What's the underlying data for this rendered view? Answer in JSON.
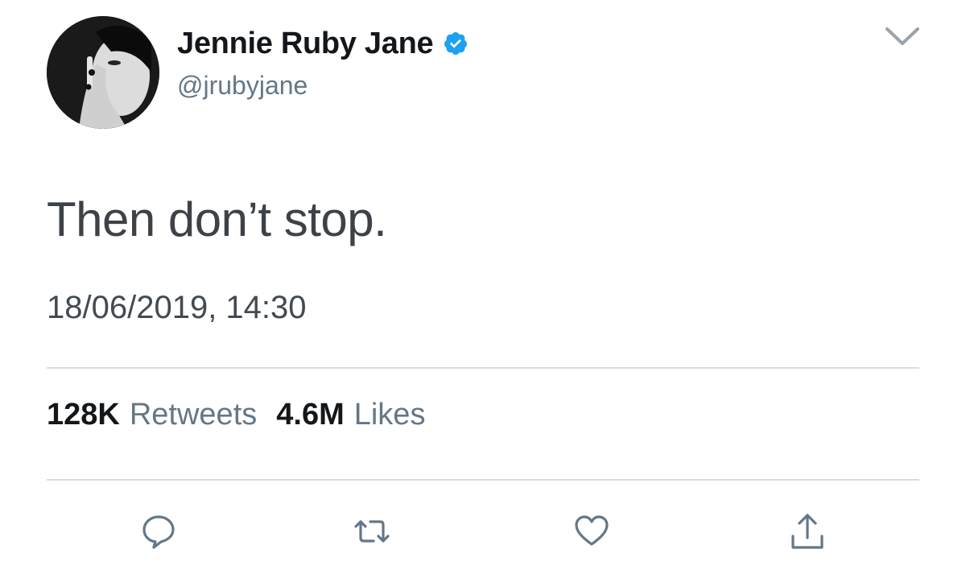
{
  "tweet": {
    "author": {
      "display_name": "Jennie Ruby Jane",
      "handle": "@jrubyjane",
      "verified": true
    },
    "text": "Then don’t stop.",
    "timestamp": "18/06/2019, 14:30",
    "stats": {
      "retweets_count": "128K",
      "retweets_label": "Retweets",
      "likes_count": "4.6M",
      "likes_label": "Likes"
    }
  },
  "icons": {
    "verified": "verified-badge-icon",
    "menu": "chevron-down-icon",
    "reply": "reply-bubble-icon",
    "retweet": "retweet-icon",
    "like": "heart-icon",
    "share": "share-icon"
  },
  "colors": {
    "verified_blue": "#1da1f2",
    "text_primary": "#14171a",
    "text_secondary": "#657786",
    "icon_gray": "#657786",
    "divider": "#d8dde2"
  }
}
